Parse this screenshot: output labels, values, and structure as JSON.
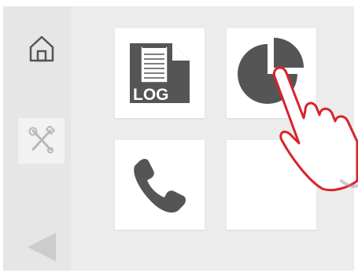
{
  "sidebar": {
    "items": [
      {
        "icon": "home-icon"
      },
      {
        "icon": "tools-icon"
      },
      {
        "icon": "back-arrow-icon"
      }
    ]
  },
  "tiles": [
    {
      "icon": "log-file-icon",
      "label": "LOG"
    },
    {
      "icon": "pie-chart-icon"
    },
    {
      "icon": "phone-icon"
    },
    {
      "icon": ""
    }
  ],
  "overlay": {
    "icon": "pointing-hand-icon"
  },
  "colors": {
    "icon_dark": "#555555",
    "hand_outline": "#d9232a",
    "tools_icon": "#b8b8b8",
    "back_arrow": "#cccccc"
  }
}
